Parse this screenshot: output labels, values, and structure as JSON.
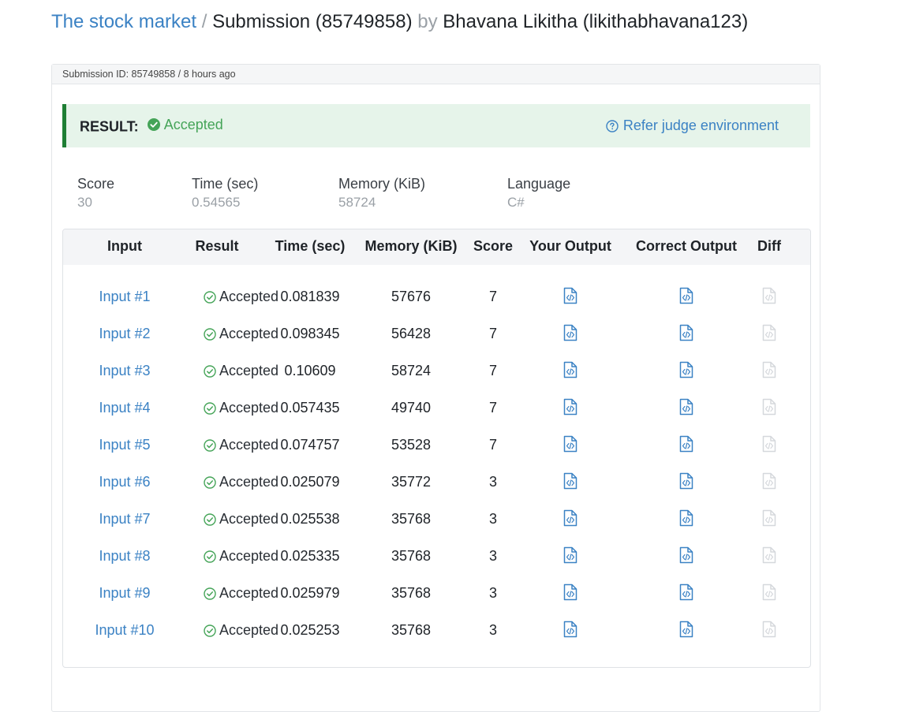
{
  "header": {
    "problem_link": "The stock market",
    "separator": "/",
    "submission_text": "Submission (85749858)",
    "by": "by",
    "user": "Bhavana Likitha (likithabhavana123)"
  },
  "card": {
    "meta": "Submission ID: 85749858 / 8 hours ago"
  },
  "result": {
    "label": "RESULT:",
    "status": "Accepted",
    "judge_link": "Refer judge environment"
  },
  "stats": {
    "score_label": "Score",
    "score": "30",
    "time_label": "Time (sec)",
    "time": "0.54565",
    "memory_label": "Memory (KiB)",
    "memory": "58724",
    "language_label": "Language",
    "language": "C#"
  },
  "table": {
    "headers": [
      "Input",
      "Result",
      "Time (sec)",
      "Memory (KiB)",
      "Score",
      "Your Output",
      "Correct Output",
      "Diff"
    ],
    "rows": [
      {
        "input": "Input #1",
        "result": "Accepted",
        "time": "0.081839",
        "memory": "57676",
        "score": "7"
      },
      {
        "input": "Input #2",
        "result": "Accepted",
        "time": "0.098345",
        "memory": "56428",
        "score": "7"
      },
      {
        "input": "Input #3",
        "result": "Accepted",
        "time": "0.10609",
        "memory": "58724",
        "score": "7"
      },
      {
        "input": "Input #4",
        "result": "Accepted",
        "time": "0.057435",
        "memory": "49740",
        "score": "7"
      },
      {
        "input": "Input #5",
        "result": "Accepted",
        "time": "0.074757",
        "memory": "53528",
        "score": "7"
      },
      {
        "input": "Input #6",
        "result": "Accepted",
        "time": "0.025079",
        "memory": "35772",
        "score": "3"
      },
      {
        "input": "Input #7",
        "result": "Accepted",
        "time": "0.025538",
        "memory": "35768",
        "score": "3"
      },
      {
        "input": "Input #8",
        "result": "Accepted",
        "time": "0.025335",
        "memory": "35768",
        "score": "3"
      },
      {
        "input": "Input #9",
        "result": "Accepted",
        "time": "0.025979",
        "memory": "35768",
        "score": "3"
      },
      {
        "input": "Input #10",
        "result": "Accepted",
        "time": "0.025253",
        "memory": "35768",
        "score": "3"
      }
    ]
  },
  "icons": {
    "output": "code-file-icon",
    "diff": "diff-file-icon",
    "accepted": "check-circle-icon",
    "help": "question-circle-icon"
  },
  "colors": {
    "link": "#3b82c4",
    "accepted": "#45a458",
    "result_bg": "#e6f4ea",
    "result_border": "#1e7e34",
    "icon_disabled": "#d5d8dc"
  }
}
